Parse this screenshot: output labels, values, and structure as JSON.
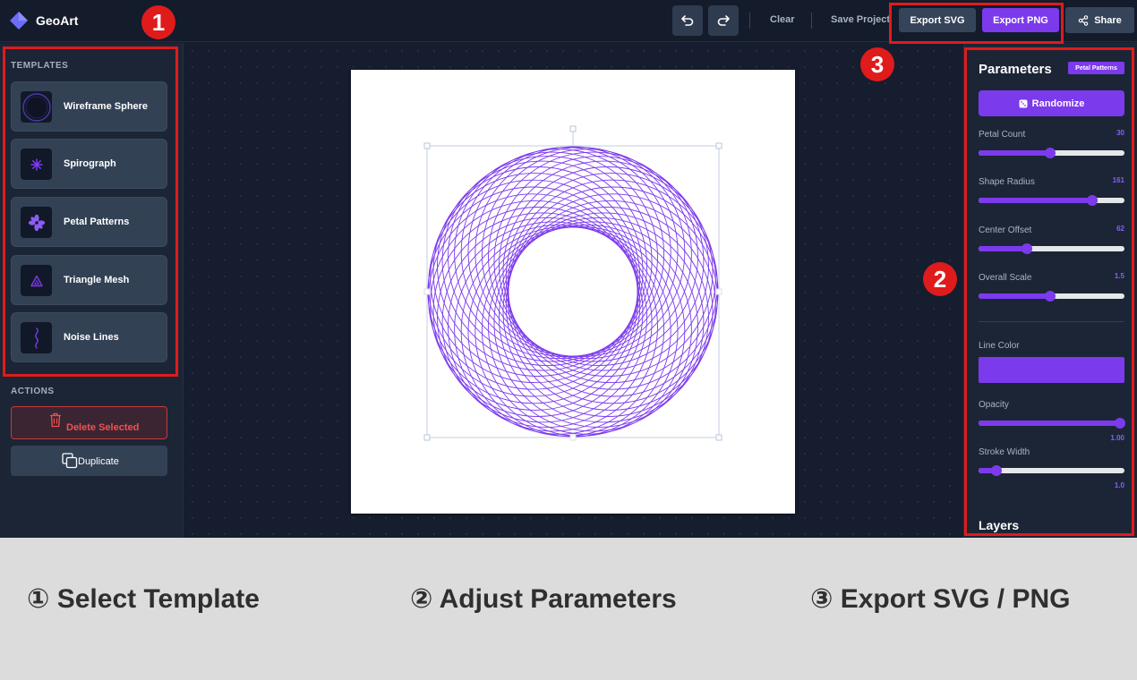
{
  "app": {
    "name": "GeoArt"
  },
  "toolbar": {
    "clear_label": "Clear",
    "save_label": "Save Project",
    "export_svg_label": "Export SVG",
    "export_png_label": "Export PNG",
    "share_label": "Share"
  },
  "templates": {
    "heading": "TEMPLATES",
    "items": [
      {
        "label": "Wireframe Sphere",
        "icon": "sphere-icon"
      },
      {
        "label": "Spirograph",
        "icon": "spirograph-icon"
      },
      {
        "label": "Petal Patterns",
        "icon": "petal-icon"
      },
      {
        "label": "Triangle Mesh",
        "icon": "triangle-icon"
      },
      {
        "label": "Noise Lines",
        "icon": "noise-line-icon"
      }
    ]
  },
  "actions": {
    "heading": "ACTIONS",
    "delete_label": "Delete Selected",
    "duplicate_label": "Duplicate"
  },
  "canvas": {
    "artwork": {
      "template": "Petal Patterns",
      "rings": 36,
      "stroke_color": "#7c3aed"
    }
  },
  "parameters": {
    "title": "Parameters",
    "badge": "Petal Patterns",
    "randomize_label": "Randomize",
    "sliders": [
      {
        "label": "Petal Count",
        "value": "30",
        "fraction": 0.49
      },
      {
        "label": "Shape Radius",
        "value": "161",
        "fraction": 0.78
      },
      {
        "label": "Center Offset",
        "value": "62",
        "fraction": 0.33
      },
      {
        "label": "Overall Scale",
        "value": "1.5",
        "fraction": 0.49
      }
    ],
    "line_color_label": "Line Color",
    "line_color": "#7c3aed",
    "opacity": {
      "label": "Opacity",
      "value": "1.00",
      "fraction": 0.97
    },
    "stroke_width": {
      "label": "Stroke Width",
      "value": "1.0",
      "fraction": 0.12
    },
    "layers_title": "Layers"
  },
  "annotations": {
    "steps": [
      {
        "number": "1",
        "caption": "① Select Template"
      },
      {
        "number": "2",
        "caption": "② Adjust Parameters"
      },
      {
        "number": "3",
        "caption": "③ Export SVG / PNG"
      }
    ],
    "highlight_color": "#e01b1b"
  }
}
